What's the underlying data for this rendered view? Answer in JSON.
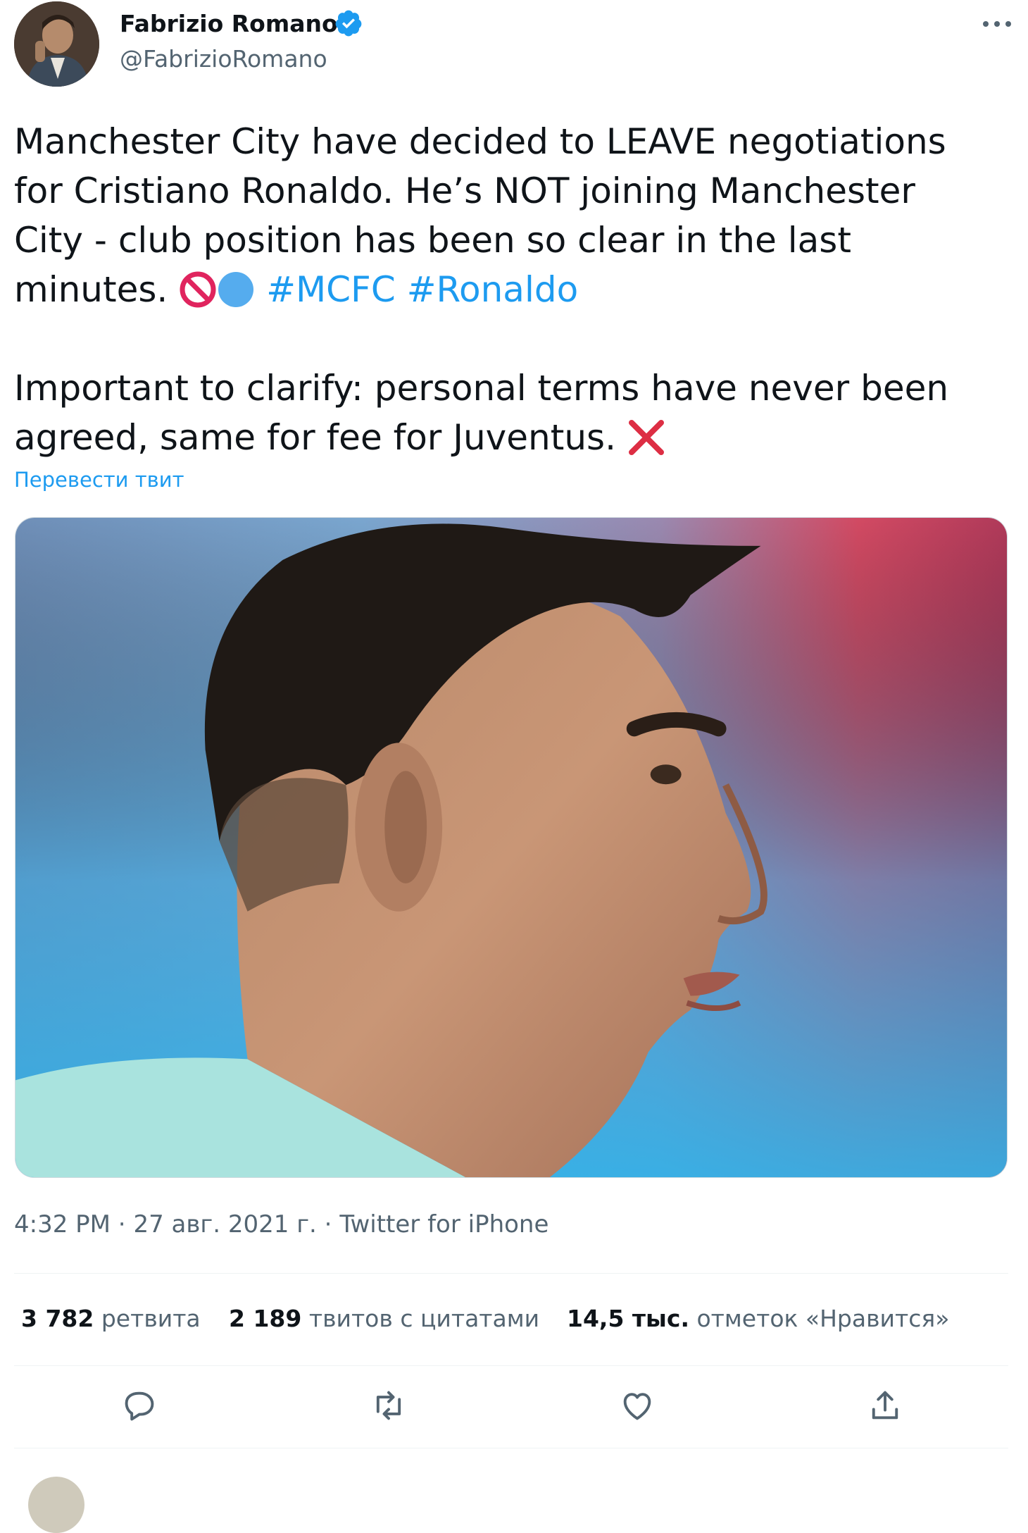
{
  "author": {
    "name": "Fabrizio Romano",
    "handle": "@FabrizioRomano",
    "verified": true
  },
  "tweet": {
    "lines": [
      "Manchester City have decided to LEAVE negotiations",
      "for Cristiano Ronaldo. He’s NOT joining Manchester",
      "City - club position has been so clear in the last"
    ],
    "line4_text": "minutes.",
    "hashtags": [
      "#MCFC",
      "#Ronaldo"
    ],
    "para2_lines": [
      "Important to clarify: personal terms have never been",
      "agreed, same for fee for Juventus."
    ],
    "translate_label": "Перевести твит"
  },
  "media": {
    "image_icon": "portrait-photo"
  },
  "meta": {
    "time": "4:32 PM",
    "date": "27 авг. 2021 г.",
    "source": "Twitter for iPhone",
    "separator": " · "
  },
  "stats": {
    "retweets_count": "3 782",
    "retweets_label": "ретвита",
    "quotes_count": "2 189",
    "quotes_label": "твитов с цитатами",
    "likes_count": "14,5 тыс.",
    "likes_label": "отметок «Нравится»"
  },
  "actions": [
    "reply-icon",
    "retweet-icon",
    "like-icon",
    "share-icon"
  ],
  "colors": {
    "accent": "#1d9bf0",
    "text": "#0f1419",
    "secondary": "#536471",
    "prohibited": "#e0245e",
    "cross": "#dd2e44"
  }
}
